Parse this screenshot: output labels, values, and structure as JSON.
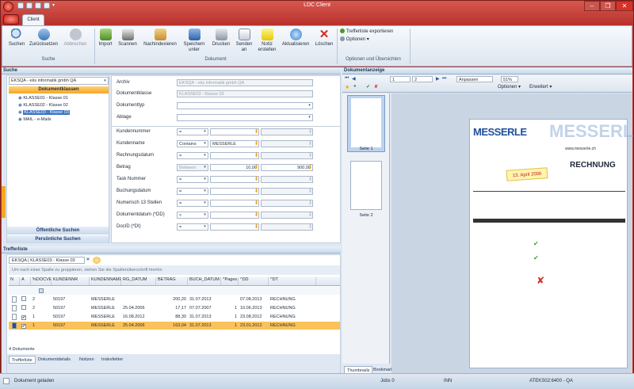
{
  "window": {
    "title": "LDC Client"
  },
  "ribbon_tabs": [
    "Client"
  ],
  "groups": {
    "suche": "Suche",
    "dokument": "Dokument",
    "optionen": "Optionen und Übersichten"
  },
  "buttons": {
    "suchen": "Suchen",
    "zuruecksetzen": "Zurücksetzen",
    "abbrechen": "Abbrechen",
    "import": "Import",
    "scannen": "Scannen",
    "nachindexieren": "Nachindexieren",
    "speichern_unter": "Speichern unter",
    "drucken": "Drucken",
    "senden_an": "Senden an",
    "notiz": "Notiz erstellen",
    "aktualisieren": "Aktualisieren",
    "loeschen": "Löschen",
    "trefferliste_exportieren": "Trefferliste exportieren",
    "optionen": "Optionen"
  },
  "search_panel": {
    "header": "Suche",
    "archive_select": "EKSQA - eks informatik gmbh QA",
    "dokumentklassen": "Dokumentklassen",
    "tree": [
      "KLASSE01 - Klasse 01",
      "KLASSE02 - Klasse 02",
      "KLASSE03 - Klasse 03",
      "MAIL - e-Mails"
    ],
    "oeffentliche": "Öffentliche Suchen",
    "persoenliche": "Persönliche Suchen"
  },
  "form": {
    "archiv_label": "Archiv",
    "archiv_value": "EKSQA - eks informatik gmbh QA",
    "klasse_label": "Dokumentklasse",
    "klasse_value": "KLASSE03 - Klasse 03",
    "typ_label": "Dokumenttyp",
    "ablage_label": "Ablage",
    "fields": [
      {
        "label": "Kundennummer",
        "op": "=",
        "v1": "",
        "v2": ""
      },
      {
        "label": "Kundenname",
        "op": "Contains",
        "v1": "MESSERLE",
        "v2": ""
      },
      {
        "label": "Rechnungsdatum",
        "op": "=",
        "v1": "",
        "v2": ""
      },
      {
        "label": "Betrag",
        "op": "Between",
        "v1": "10,00",
        "v2": "900,00"
      },
      {
        "label": "Task Nummer",
        "op": "=",
        "v1": "",
        "v2": ""
      },
      {
        "label": "Buchungsdatum",
        "op": "=",
        "v1": "",
        "v2": ""
      },
      {
        "label": "Numerisch 13 Stellen",
        "op": "=",
        "v1": "",
        "v2": ""
      },
      {
        "label": "Dokumentdatum (*DD)",
        "op": "<",
        "v1": "",
        "v2": ""
      },
      {
        "label": "DocID (*DI)",
        "op": "=",
        "v1": "",
        "v2": ""
      }
    ]
  },
  "results": {
    "header": "Trefferliste",
    "tab": "EKSQA | KLASSE03 - Klasse 03",
    "group_hint": "Um nach einer Spalte zu gruppieren, ziehen Sie die Spaltenüberschrift hierhin",
    "columns": [
      "N",
      "A",
      "%DOCVERSION",
      "KUNDENNR",
      "KUNDENNAME",
      "RG_DATUM",
      "BETRAG",
      "BUCH_DATUM",
      "^Pages",
      "^DD",
      "^DT"
    ],
    "rows": [
      [
        "",
        "",
        "2",
        "50197",
        "MESSERLE",
        "",
        "200,20",
        "31.07.2013",
        "",
        "07.08.2013",
        "RECHNUNG"
      ],
      [
        "",
        "",
        "2",
        "50197",
        "MESSERLE",
        "25.04.2006",
        "17,17",
        "07.07.2007",
        "1",
        "10.06.2013",
        "RECHNUNG"
      ],
      [
        "",
        "✔",
        "1",
        "50197",
        "MESSERLE",
        "16.08.2012",
        "88,30",
        "31.07.2013",
        "1",
        "23.08.2012",
        "RECHNUNG"
      ],
      [
        "",
        "✔",
        "1",
        "50197",
        "MESSERLE",
        "25.04.2006",
        "163,04",
        "31.07.2013",
        "1",
        "23.01.2012",
        "RECHNUNG"
      ]
    ],
    "count": "4 Dokumente",
    "bottom_tabs": [
      "Trefferliste",
      "Dokumentdetails",
      "Notizen",
      "Indexfelder"
    ]
  },
  "viewer": {
    "header": "Dokumentanzeige",
    "page": "1",
    "total": "2",
    "fit": "Anpassen",
    "zoom": "51%",
    "optionen": "Optionen",
    "erweitert": "Erweitert",
    "thumbs": [
      "Seite 1",
      "Seite 2"
    ],
    "tabs": [
      "Thumbnails",
      "Bookmarks"
    ],
    "doc": {
      "logo": "MESSERLE",
      "title": "RECHNUNG",
      "stamp": "13. April 2006",
      "www": "www.messerle.ch"
    }
  },
  "status": {
    "msg": "Dokument geladen",
    "jobs": "Jobs 0",
    "inn": "INN",
    "server": "ATEKS02:6400 - QA"
  },
  "colors": {
    "accent": "#f5a623",
    "frame": "#c93a33",
    "selected": "#f9c25a"
  }
}
